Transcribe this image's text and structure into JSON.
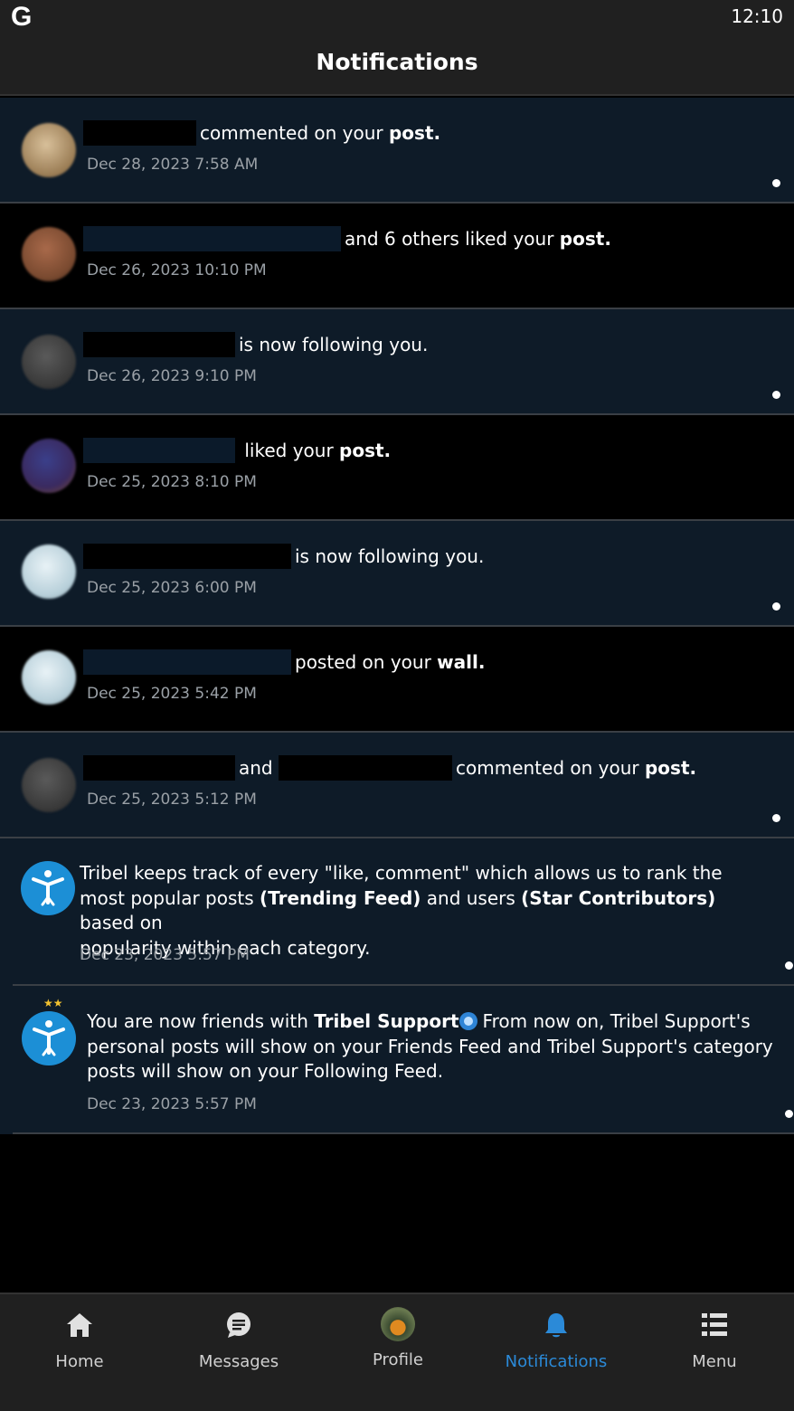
{
  "status_bar": {
    "app_logo": "G",
    "time": "12:10"
  },
  "header": {
    "title": "Notifications"
  },
  "notifications": [
    {
      "text": "commented on your",
      "object": "post.",
      "time": "Dec 28, 2023 7:58 AM",
      "unread": true
    },
    {
      "text": "and 6 others liked your",
      "object": "post.",
      "time": "Dec 26, 2023 10:10 PM",
      "unread": false
    },
    {
      "text": "is now following you.",
      "object": "",
      "time": "Dec 26, 2023 9:10 PM",
      "unread": true
    },
    {
      "text": "liked your",
      "object": "post.",
      "time": "Dec 25, 2023 8:10 PM",
      "unread": false
    },
    {
      "text": "is now following you.",
      "object": "",
      "time": "Dec 25, 2023 6:00 PM",
      "unread": true
    },
    {
      "text": "posted on your",
      "object": "wall.",
      "time": "Dec 25, 2023 5:42 PM",
      "unread": false
    },
    {
      "connector": "and",
      "text": "commented on your",
      "object": "post.",
      "time": "Dec 25, 2023 5:12 PM",
      "unread": true
    }
  ],
  "system_notifications": [
    {
      "line1": "Tribel keeps track of every \"like, comment\" which allows us to rank the",
      "line2_pre": "most popular posts ",
      "line2_bold1": "(Trending Feed)",
      "line2_mid": " and users  ",
      "line2_bold2": "(Star Contributors)",
      "line2_post": " based on",
      "line3": "popularity within each category.",
      "time": "Dec 23, 2023 5:57 PM"
    },
    {
      "pre": "You are now friends with ",
      "bold": "Tribel Support",
      "post1": "From now on, Tribel Support's",
      "line2": "personal posts will show on your Friends Feed and Tribel Support's category",
      "line3": "posts will show on your Following Feed.",
      "time": "Dec 23, 2023 5:57 PM"
    }
  ],
  "bottom_nav": [
    {
      "label": "Home",
      "icon": "home-icon",
      "active": false
    },
    {
      "label": "Messages",
      "icon": "messages-icon",
      "active": false
    },
    {
      "label": "Profile",
      "icon": "profile-avatar",
      "active": false
    },
    {
      "label": "Notifications",
      "icon": "bell-icon",
      "active": true
    },
    {
      "label": "Menu",
      "icon": "menu-list-icon",
      "active": false
    }
  ],
  "colors": {
    "accent": "#2b8ad8",
    "unread_bg": "#0e1b28",
    "tribel_blue": "#1c8fd6"
  }
}
